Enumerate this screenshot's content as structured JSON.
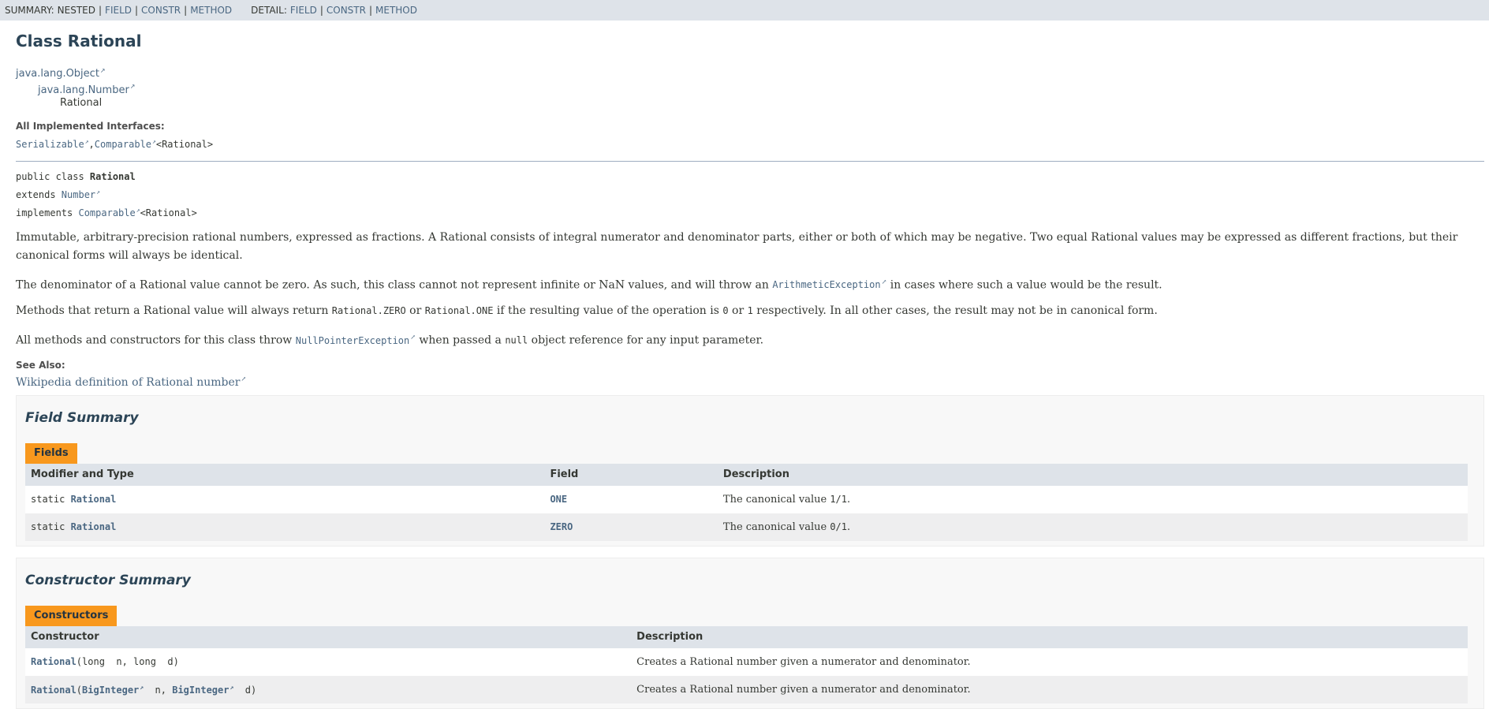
{
  "subnav": {
    "summary_prefix": "SUMMARY:",
    "summary_nested": "NESTED",
    "summary_field": "FIELD",
    "summary_constr": "CONSTR",
    "summary_method": "METHOD",
    "detail_prefix": "DETAIL:",
    "detail_field": "FIELD",
    "detail_constr": "CONSTR",
    "detail_method": "METHOD",
    "separator": "|"
  },
  "header": {
    "title": "Class Rational"
  },
  "inheritance": {
    "object": "java.lang.Object",
    "number": "java.lang.Number",
    "rational": "Rational"
  },
  "interfaces": {
    "heading": "All Implemented Interfaces:",
    "serializable": "Serializable",
    "comparable": "Comparable",
    "comparable_type": "<Rational>",
    "comma": ","
  },
  "signature": {
    "line1_prefix": "public class ",
    "line1_name": "Rational",
    "line2_prefix": "extends ",
    "line2_link": "Number",
    "line3_prefix": "implements ",
    "line3_link": "Comparable",
    "line3_type": "<Rational>"
  },
  "description": {
    "p1": "Immutable, arbitrary-precision rational numbers, expressed as fractions. A Rational consists of integral numerator and denominator parts, either or both of which may be negative. Two equal Rational values may be expressed as different fractions, but their canonical forms will always be identical.",
    "p2_before": "The denominator of a Rational value cannot be zero. As such, this class cannot not represent infinite or NaN values, and will throw an ",
    "p2_link": "ArithmeticException",
    "p2_after": " in cases where such a value would be the result.",
    "p3_a": "Methods that return a Rational value will always return ",
    "p3_code1": "Rational.ZERO",
    "p3_b": " or ",
    "p3_code2": "Rational.ONE",
    "p3_c": " if the resulting value of the operation is ",
    "p3_code3": "0",
    "p3_d": " or ",
    "p3_code4": "1",
    "p3_e": " respectively. In all other cases, the result may not be in canonical form.",
    "p4_a": "All methods and constructors for this class throw ",
    "p4_link": "NullPointerException",
    "p4_b": " when passed a ",
    "p4_code": "null",
    "p4_c": " object reference for any input parameter."
  },
  "see_also": {
    "heading": "See Also:",
    "link": "Wikipedia definition of Rational number"
  },
  "field_summary": {
    "heading": "Field Summary",
    "caption": "Fields",
    "columns": [
      "Modifier and Type",
      "Field",
      "Description"
    ],
    "rows": [
      {
        "modifier": "static ",
        "type": "Rational",
        "field": "ONE",
        "desc_a": "The canonical value ",
        "desc_code": "1/1",
        "desc_b": "."
      },
      {
        "modifier": "static ",
        "type": "Rational",
        "field": "ZERO",
        "desc_a": "The canonical value ",
        "desc_code": "0/1",
        "desc_b": "."
      }
    ]
  },
  "constructor_summary": {
    "heading": "Constructor Summary",
    "caption": "Constructors",
    "columns": [
      "Constructor",
      "Description"
    ],
    "rows": [
      {
        "name": "Rational",
        "params_a": "(long  n, long  d)",
        "description": "Creates a Rational number given a numerator and denominator."
      },
      {
        "name": "Rational",
        "p_open": "(",
        "type1": "BigInteger",
        "p_mid": "  n, ",
        "type2": "BigInteger",
        "p_close": "  d)",
        "description": "Creates a Rational number given a numerator and denominator."
      }
    ]
  }
}
